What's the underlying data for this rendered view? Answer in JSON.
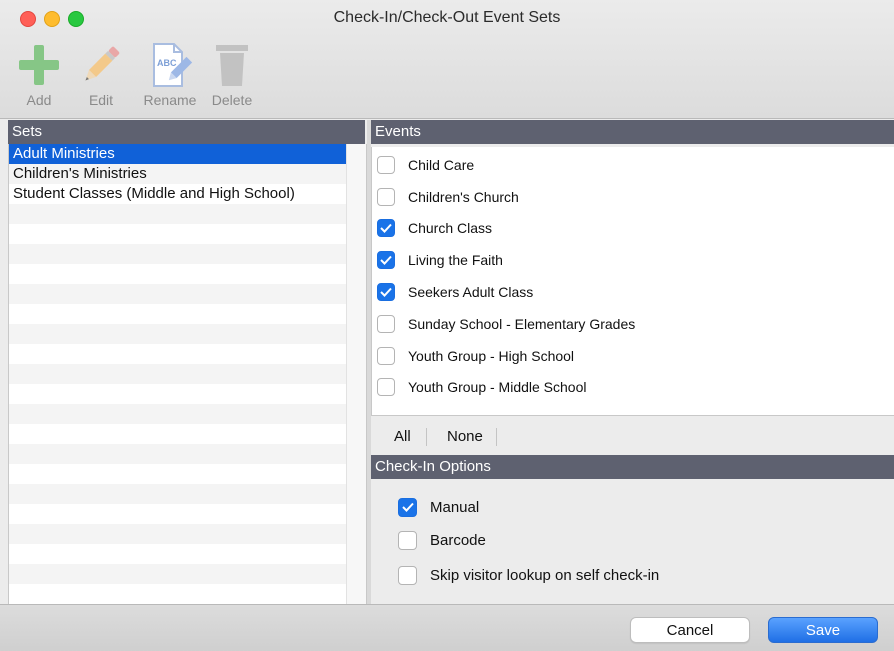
{
  "window": {
    "title": "Check-In/Check-Out Event Sets"
  },
  "toolbar": {
    "add_label": "Add",
    "edit_label": "Edit",
    "rename_label": "Rename",
    "delete_label": "Delete"
  },
  "sets": {
    "header": "Sets",
    "items": [
      {
        "label": "Adult Ministries",
        "selected": true
      },
      {
        "label": "Children's Ministries",
        "selected": false
      },
      {
        "label": "Student Classes (Middle and High School)",
        "selected": false
      }
    ]
  },
  "events": {
    "header": "Events",
    "items": [
      {
        "label": "Child Care",
        "checked": false
      },
      {
        "label": "Children's Church",
        "checked": false
      },
      {
        "label": "Church Class",
        "checked": true
      },
      {
        "label": "Living the Faith",
        "checked": true
      },
      {
        "label": "Seekers Adult Class",
        "checked": true
      },
      {
        "label": "Sunday School - Elementary Grades",
        "checked": false
      },
      {
        "label": "Youth Group - High School",
        "checked": false
      },
      {
        "label": "Youth Group - Middle School",
        "checked": false
      }
    ],
    "all_label": "All",
    "none_label": "None"
  },
  "checkin_options": {
    "header": "Check-In Options",
    "items": [
      {
        "label": "Manual",
        "checked": true
      },
      {
        "label": "Barcode",
        "checked": false
      },
      {
        "label": "Skip visitor lookup on self check-in",
        "checked": false
      }
    ]
  },
  "footer": {
    "cancel_label": "Cancel",
    "save_label": "Save"
  },
  "colors": {
    "accent": "#1a73e8",
    "header_bg": "#5e6170",
    "selection": "#1061d8"
  }
}
